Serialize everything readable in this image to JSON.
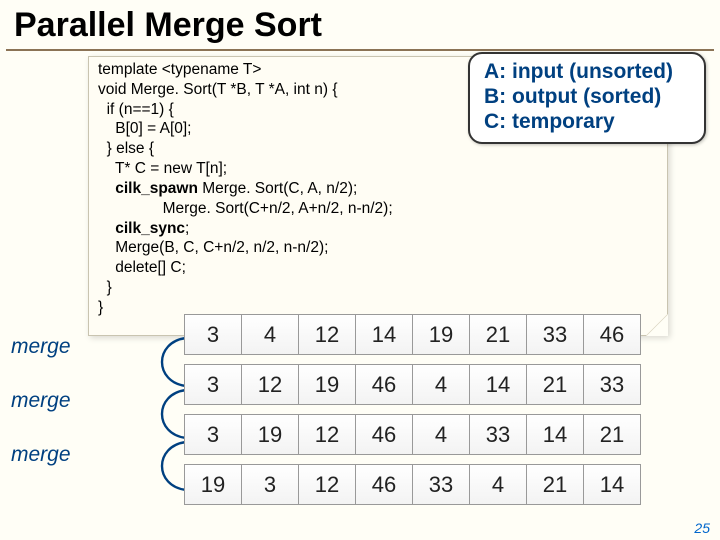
{
  "title": "Parallel Merge Sort",
  "code": {
    "l1": "template <typename T>",
    "l2": "void Merge. Sort(T *B, T *A, int n) {",
    "l3": "  if (n==1) {",
    "l4": "    B[0] = A[0];",
    "l5": "  } else {",
    "l6": "    T* C = new T[n];",
    "l7a": "    ",
    "l7kw": "cilk_spawn",
    "l7b": " Merge. Sort(C, A, n/2);",
    "l8": "               Merge. Sort(C+n/2, A+n/2, n-n/2);",
    "l9a": "    ",
    "l9kw": "cilk_sync",
    "l9b": ";",
    "l10": "    Merge(B, C, C+n/2, n/2, n-n/2);",
    "l11": "    delete[] C;",
    "l12": "  }",
    "l13": "}"
  },
  "legend": {
    "a": "A: input (unsorted)",
    "b": "B: output (sorted)",
    "c": "C: temporary"
  },
  "merge_label": "merge",
  "rows": [
    [
      "3",
      "4",
      "12",
      "14",
      "19",
      "21",
      "33",
      "46"
    ],
    [
      "3",
      "12",
      "19",
      "46",
      "4",
      "14",
      "21",
      "33"
    ],
    [
      "3",
      "19",
      "12",
      "46",
      "4",
      "33",
      "14",
      "21"
    ],
    [
      "19",
      "3",
      "12",
      "46",
      "33",
      "4",
      "21",
      "14"
    ]
  ],
  "pagenum": "25"
}
